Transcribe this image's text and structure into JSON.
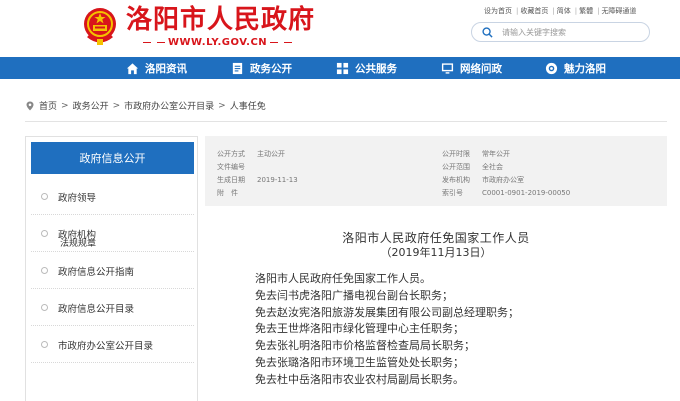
{
  "header": {
    "title": "洛阳市人民政府",
    "url": "WWW.LY.GOV.CN",
    "toplinks": [
      "设为首页",
      "收藏首页",
      "简体",
      "繁體",
      "无障碍通道"
    ],
    "search_placeholder": "请输入关键字搜索"
  },
  "nav": {
    "items": [
      {
        "label": "洛阳资讯",
        "icon": "home-icon"
      },
      {
        "label": "政务公开",
        "icon": "document-icon"
      },
      {
        "label": "公共服务",
        "icon": "grid-icon"
      },
      {
        "label": "网络问政",
        "icon": "monitor-icon"
      },
      {
        "label": "魅力洛阳",
        "icon": "camera-icon"
      }
    ]
  },
  "breadcrumb": [
    "首页",
    "政务公开",
    "市政府办公室公开目录",
    "人事任免"
  ],
  "sidebar": {
    "heading": "政府信息公开",
    "items": [
      "政府领导",
      "政府机构",
      "政府信息公开指南",
      "政府信息公开目录",
      "市政府办公室公开目录"
    ],
    "sub_item": "法规规章"
  },
  "meta": {
    "publish_method_label": "公开方式",
    "publish_method": "主动公开",
    "doc_no_label": "文件编号",
    "doc_no": "",
    "date_label": "生成日期",
    "date": "2019-11-13",
    "attachment_label": "附　件",
    "attachment": "",
    "period_label": "公开时限",
    "period": "常年公开",
    "scope_label": "公开范围",
    "scope": "全社会",
    "issuer_label": "发布机构",
    "issuer": "市政府办公室",
    "index_label": "索引号",
    "index": "C0001-0901-2019-00050"
  },
  "document": {
    "title": "洛阳市人民政府任免国家工作人员",
    "date": "（2019年11月13日）",
    "lines": [
      "洛阳市人民政府任免国家工作人员。",
      "免去闫书虎洛阳广播电视台副台长职务；",
      "免去赵汝宪洛阳旅游发展集团有限公司副总经理职务；",
      "免去王世烨洛阳市绿化管理中心主任职务；",
      "免去张礼明洛阳市价格监督检查局局长职务；",
      "免去张璐洛阳市环境卫生监管处处长职务；",
      "免去杜中岳洛阳市农业农村局副局长职务。"
    ]
  },
  "colors": {
    "brand_red": "#d8151b",
    "nav_blue": "#1f6fbf"
  }
}
